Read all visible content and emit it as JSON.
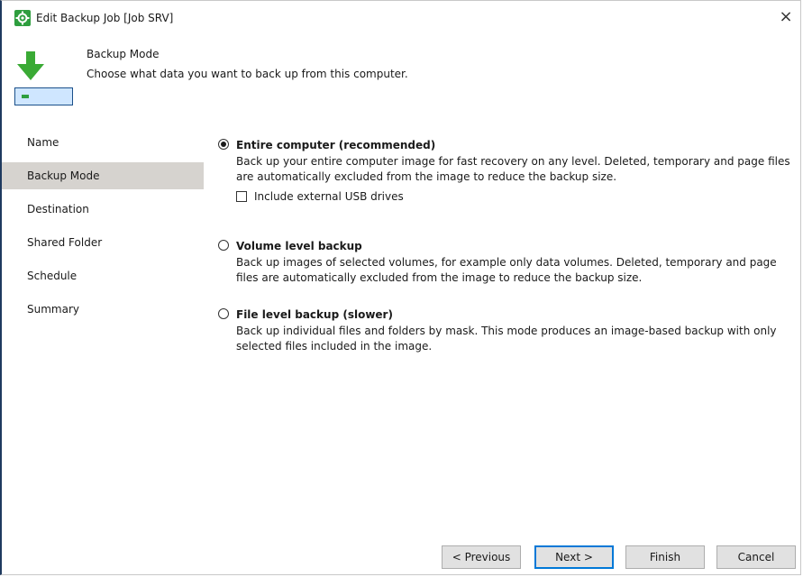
{
  "window": {
    "title": "Edit Backup Job [Job SRV]",
    "close_glyph": "×"
  },
  "header": {
    "title": "Backup Mode",
    "description": "Choose what data you want to back up from this computer."
  },
  "sidebar": {
    "items": [
      {
        "label": "Name",
        "active": false
      },
      {
        "label": "Backup Mode",
        "active": true
      },
      {
        "label": "Destination",
        "active": false
      },
      {
        "label": "Shared Folder",
        "active": false
      },
      {
        "label": "Schedule",
        "active": false
      },
      {
        "label": "Summary",
        "active": false
      }
    ]
  },
  "options": [
    {
      "title": "Entire computer (recommended)",
      "description": "Back up your entire computer image for fast recovery on any level. Deleted, temporary and page files are automatically excluded from the image to reduce the backup size.",
      "checked": true,
      "checkbox": {
        "label": "Include external USB drives",
        "checked": false
      }
    },
    {
      "title": "Volume level backup",
      "description": "Back up images of selected volumes, for example only data volumes. Deleted, temporary and page files are automatically excluded from the image to reduce the backup size.",
      "checked": false
    },
    {
      "title": "File level backup (slower)",
      "description": "Back up individual files and folders by mask. This mode produces an image-based backup with only selected files included in the image.",
      "checked": false
    }
  ],
  "buttons": {
    "previous": "< Previous",
    "next": "Next >",
    "finish": "Finish",
    "cancel": "Cancel"
  },
  "colors": {
    "accent": "#0078d7",
    "arrow_green": "#3aaa35",
    "sidebar_active": "#d6d3cf",
    "drive_fill": "#cfe6ff"
  },
  "icons": {
    "app": "veeam-settings-icon",
    "header": "backup-arrow-drive-icon",
    "close": "close-icon"
  }
}
